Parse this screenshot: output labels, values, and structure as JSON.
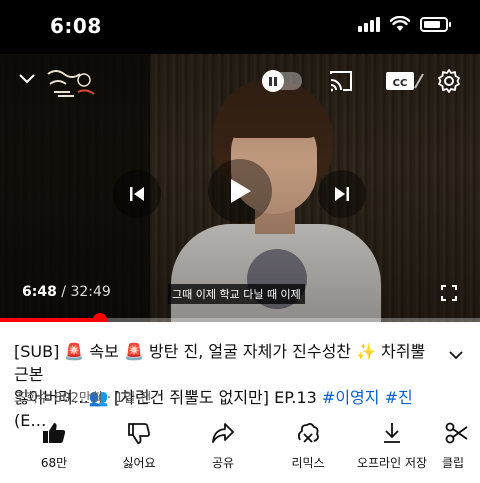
{
  "status_bar": {
    "time": "6:08"
  },
  "player": {
    "current_time": "6:48",
    "separator": " / ",
    "duration": "32:49",
    "subtitle": "그때 이제 학교 다닐 때 이제",
    "progress_fraction": 0.2075
  },
  "video": {
    "title_line1": "[SUB] 🚨 속보 🚨  방탄 진, 얼굴 자체가 진수성찬 ✨  차쥐뿔 근본",
    "title_line2_pre": "잃어버려…👥     [차린건 쥐뿔도 없지만] EP.13 ",
    "tag1": "#이영지",
    "tag2": "#진",
    "title_line2_post": " (E…",
    "meta": "조회수 802만회 · 1일 전"
  },
  "actions": {
    "like": "68만",
    "dislike": "싫어요",
    "share": "공유",
    "remix": "리믹스",
    "download": "오프라인 저장",
    "clip": "클립"
  },
  "colors": {
    "accent": "#ff0000",
    "link": "#065fd4"
  }
}
